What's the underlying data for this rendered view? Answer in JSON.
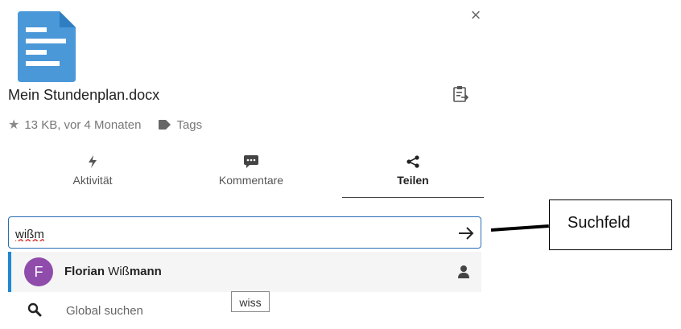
{
  "panel": {
    "close_symbol": "×",
    "file_name": "Mein Stundenplan.docx",
    "file_meta": "13 KB, vor 4 Monaten",
    "tags_label": "Tags"
  },
  "tabs": [
    {
      "label": "Aktivität",
      "icon": "lightning-icon",
      "active": false
    },
    {
      "label": "Kommentare",
      "icon": "comment-icon",
      "active": false
    },
    {
      "label": "Teilen",
      "icon": "share-icon",
      "active": true
    }
  ],
  "search": {
    "value": "wißm",
    "submit_icon": "arrow-right-icon"
  },
  "results": {
    "user": {
      "avatar_letter": "F",
      "name_bold": "Florian",
      "name_mid": " Wiß",
      "name_tail": "mann",
      "avatar_color": "#8f4cab"
    },
    "global_label": "Global suchen",
    "tooltip": "wiss"
  },
  "annotation": {
    "label": "Suchfeld"
  },
  "colors": {
    "file_icon": "#4a98d8",
    "accent_border": "#1e88d1",
    "search_border": "#2a6db3"
  }
}
